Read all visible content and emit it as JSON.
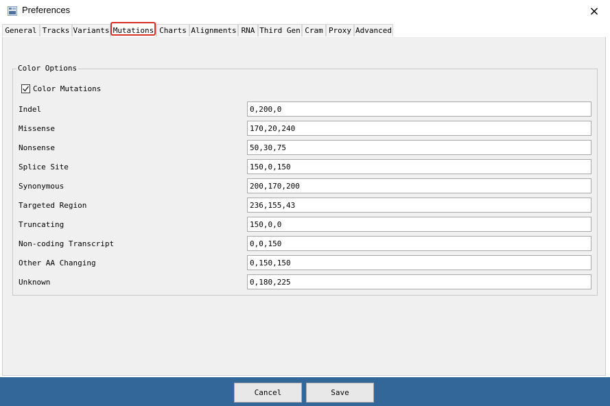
{
  "window": {
    "title": "Preferences",
    "app_icon": "igv-app-icon",
    "close_icon": "×"
  },
  "tabs": [
    {
      "label": "General"
    },
    {
      "label": "Tracks"
    },
    {
      "label": "Variants"
    },
    {
      "label": "Mutations",
      "active": true
    },
    {
      "label": "Charts"
    },
    {
      "label": "Alignments"
    },
    {
      "label": "RNA"
    },
    {
      "label": "Third Gen"
    },
    {
      "label": "Cram"
    },
    {
      "label": "Proxy"
    },
    {
      "label": "Advanced"
    }
  ],
  "highlight_color": "#d93025",
  "color_options": {
    "legend": "Color Options",
    "color_mutations_label": "Color Mutations",
    "color_mutations_checked": true,
    "rows": [
      {
        "label": "Indel",
        "value": "0,200,0"
      },
      {
        "label": "Missense",
        "value": "170,20,240"
      },
      {
        "label": "Nonsense",
        "value": "50,30,75"
      },
      {
        "label": "Splice Site",
        "value": "150,0,150"
      },
      {
        "label": "Synonymous",
        "value": "200,170,200"
      },
      {
        "label": "Targeted Region",
        "value": "236,155,43"
      },
      {
        "label": "Truncating",
        "value": "150,0,0"
      },
      {
        "label": "Non-coding Transcript",
        "value": "0,0,150"
      },
      {
        "label": "Other AA Changing",
        "value": "0,150,150"
      },
      {
        "label": "Unknown",
        "value": "0,180,225"
      }
    ]
  },
  "footer": {
    "cancel_label": "Cancel",
    "save_label": "Save",
    "background": "#336699"
  }
}
